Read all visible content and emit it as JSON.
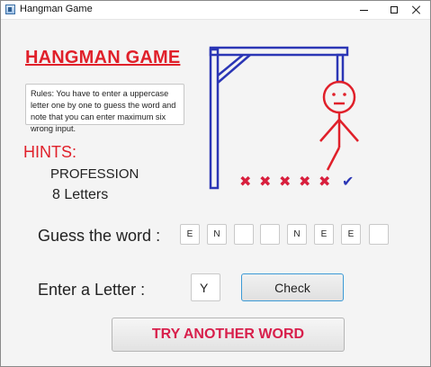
{
  "window": {
    "title": "Hangman Game"
  },
  "heading": "HANGMAN GAME",
  "rules": "Rules: You have to enter a uppercase letter one by one to guess the word and note that you can enter maximum six wrong input.",
  "hints": {
    "label": "HINTS:",
    "category": "PROFESSION",
    "length": "8 Letters"
  },
  "attempts": {
    "wrong_marks": [
      "✖",
      "✖",
      "✖",
      "✖",
      "✖"
    ],
    "correct_mark": "✔",
    "colors": {
      "gallows": "#2b36b5",
      "figure": "#e0202a",
      "wrong": "#d81f3d",
      "correct": "#2b36b5"
    }
  },
  "guess": {
    "label": "Guess the word :",
    "letters": [
      "E",
      "N",
      "",
      "",
      "N",
      "E",
      "E",
      ""
    ]
  },
  "input": {
    "label": "Enter a Letter :",
    "value": "Y"
  },
  "buttons": {
    "check": "Check",
    "try_another": "TRY ANOTHER WORD"
  }
}
